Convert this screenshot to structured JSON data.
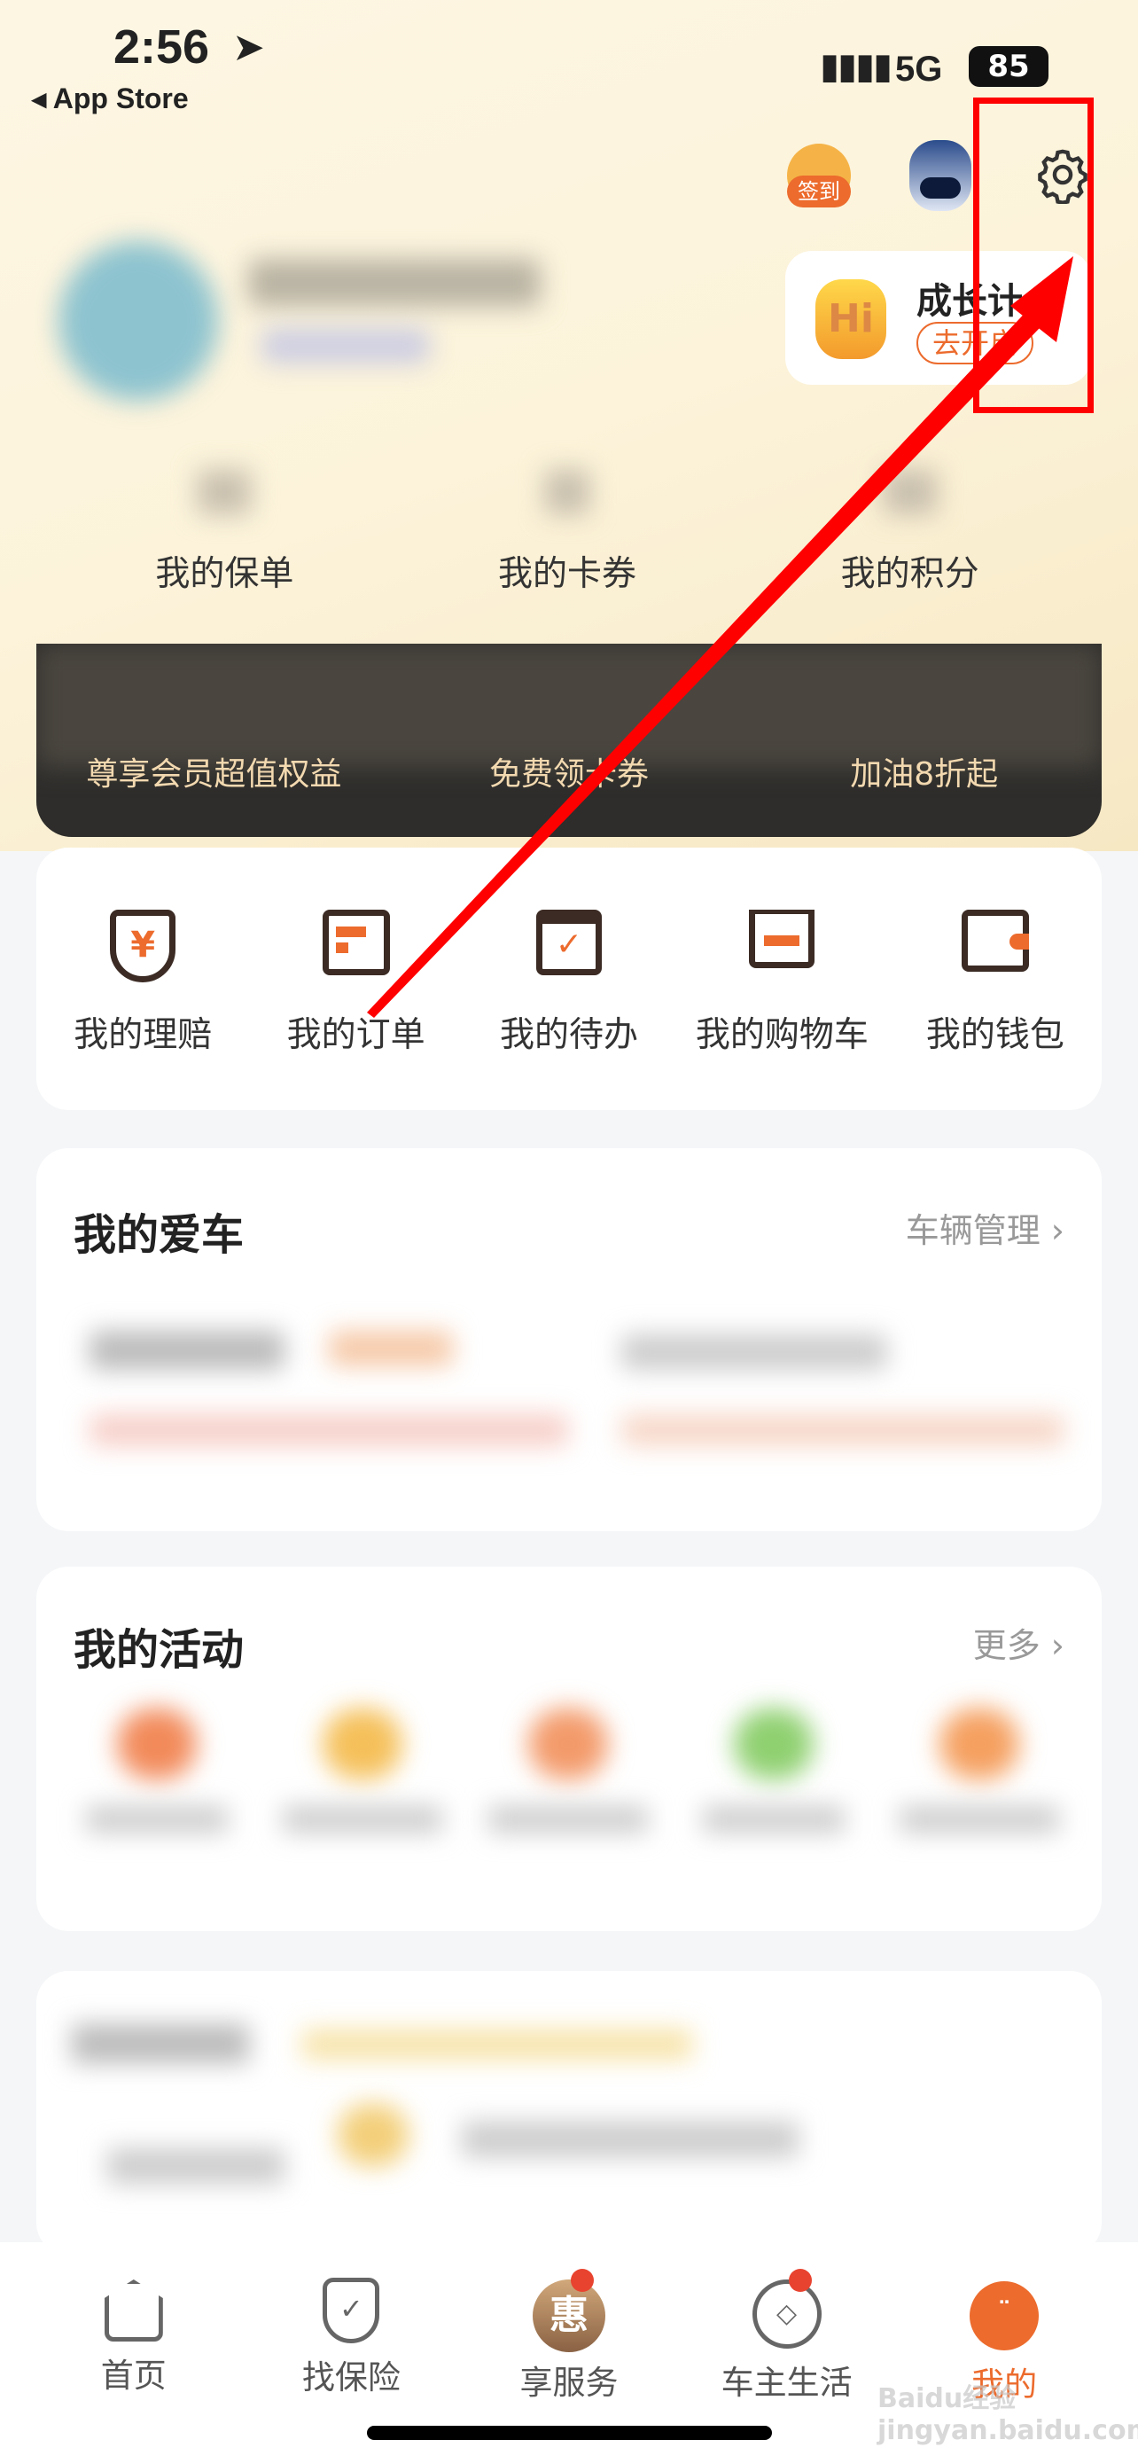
{
  "status_bar": {
    "time": "2:56",
    "back_label": "◂ App Store",
    "network": "5G",
    "battery": "85"
  },
  "header": {
    "checkin_label": "签到",
    "growth_plan": {
      "title": "成长计",
      "button": "去开启"
    }
  },
  "stats": [
    {
      "label": "我的保单"
    },
    {
      "label": "我的卡券"
    },
    {
      "label": "我的积分"
    }
  ],
  "banner": {
    "items": [
      "尊享会员超值权益",
      "免费领卡券",
      "加油8折起"
    ]
  },
  "shortcuts": [
    {
      "label": "我的理赔",
      "icon": "shield-yuan-icon"
    },
    {
      "label": "我的订单",
      "icon": "order-icon"
    },
    {
      "label": "我的待办",
      "icon": "todo-icon"
    },
    {
      "label": "我的购物车",
      "icon": "cart-icon"
    },
    {
      "label": "我的钱包",
      "icon": "wallet-icon"
    }
  ],
  "my_car": {
    "title": "我的爱车",
    "link": "车辆管理"
  },
  "activities": {
    "title": "我的活动",
    "link": "更多"
  },
  "tabbar": [
    {
      "label": "首页",
      "icon": "home-icon"
    },
    {
      "label": "找保险",
      "icon": "shield-check-icon"
    },
    {
      "label": "享服务",
      "icon": "hui-icon",
      "badge": true,
      "badge_text": "惠"
    },
    {
      "label": "车主生活",
      "icon": "compass-icon",
      "badge": true
    },
    {
      "label": "我的",
      "icon": "profile-face-icon",
      "active": true
    }
  ],
  "colors": {
    "accent": "#ec6b2d",
    "annotation": "#ff0000",
    "badge": "#e8432f"
  },
  "watermark": "Baidu经验 jingyan.baidu.com"
}
